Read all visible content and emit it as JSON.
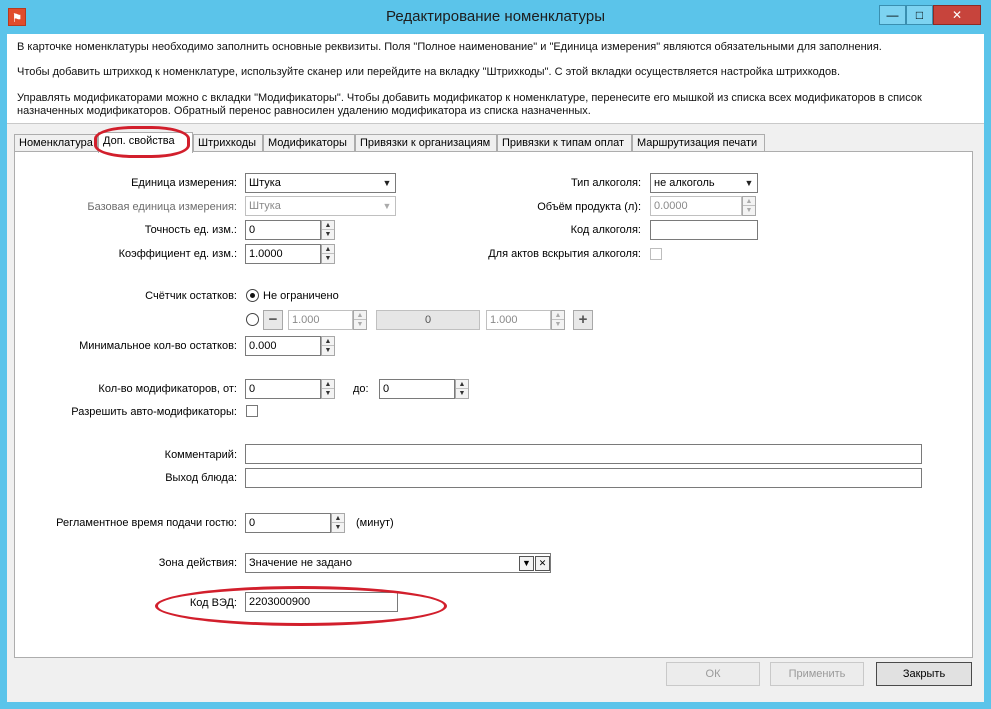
{
  "window": {
    "title": "Редактирование номенклатуры",
    "min_glyph": "—",
    "max_glyph": "□",
    "close_glyph": "✕"
  },
  "info": {
    "line1": "В карточке номенклатуры необходимо заполнить основные реквизиты.  Поля \"Полное наименование\" и \"Единица измерения\" являются обязательными для заполнения.",
    "line2": "Чтобы добавить штрихкод к номенклатуре, используйте сканер или перейдите на вкладку \"Штрихкоды\". С этой вкладки осуществляется настройка штрихкодов.",
    "line3": "Управлять модификаторами можно с вкладки \"Модификаторы\". Чтобы добавить модификатор к номенклатуре, перенесите его мышкой из списка всех модификаторов в список",
    "line4": "назначенных модификаторов. Обратный перенос равносилен удалению модификатора из списка назначенных."
  },
  "tabs": [
    {
      "label": "Номенклатура"
    },
    {
      "label": "Доп. свойства"
    },
    {
      "label": "Штрихкоды"
    },
    {
      "label": "Модификаторы"
    },
    {
      "label": "Привязки к организациям"
    },
    {
      "label": "Привязки к типам оплат"
    },
    {
      "label": "Маршрутизация печати"
    }
  ],
  "form": {
    "unit_label": "Единица измерения:",
    "unit_value": "Штука",
    "base_unit_label": "Базовая единица измерения:",
    "base_unit_value": "Штука",
    "precision_label": "Точность ед. изм.:",
    "precision_value": "0",
    "coef_label": "Коэффициент ед. изм.:",
    "coef_value": "1.0000",
    "alcohol_type_label": "Тип алкоголя:",
    "alcohol_type_value": "не алкоголь",
    "volume_label": "Объём продукта (л):",
    "volume_value": "0.0000",
    "alcohol_code_label": "Код алкоголя:",
    "alcohol_code_value": "",
    "alcohol_acts_label": "Для актов вскрытия алкоголя:",
    "counter_label": "Счётчик остатков:",
    "counter_unlimited": "Не ограничено",
    "counter_min_value": "1.000",
    "counter_mid_value": "0",
    "counter_max_value": "1.000",
    "min_stock_label": "Минимальное кол-во остатков:",
    "min_stock_value": "0.000",
    "mod_count_label": "Кол-во модификаторов, от:",
    "mod_from_value": "0",
    "mod_to_label": "до:",
    "mod_to_value": "0",
    "auto_mod_label": "Разрешить авто-модификаторы:",
    "comment_label": "Комментарий:",
    "comment_value": "",
    "yield_label": "Выход блюда:",
    "yield_value": "",
    "serve_time_label": "Регламентное время подачи гостю:",
    "serve_time_value": "0",
    "serve_time_unit": "(минут)",
    "zone_label": "Зона действия:",
    "zone_value": "Значение не задано",
    "ved_label": "Код ВЭД:",
    "ved_value": "2203000900"
  },
  "icons": {
    "dropdown_glyph": "▼",
    "spin_up_glyph": "▲",
    "spin_down_glyph": "▼",
    "minus_glyph": "−",
    "plus_glyph": "+",
    "clear_glyph": "✕",
    "app_glyph": "⚑"
  },
  "buttons": {
    "ok": "ОК",
    "apply": "Применить",
    "close": "Закрыть"
  },
  "colors": {
    "titlebar": "#5bc4ea",
    "close_button": "#c7443c",
    "annotation": "#d21f2c"
  }
}
